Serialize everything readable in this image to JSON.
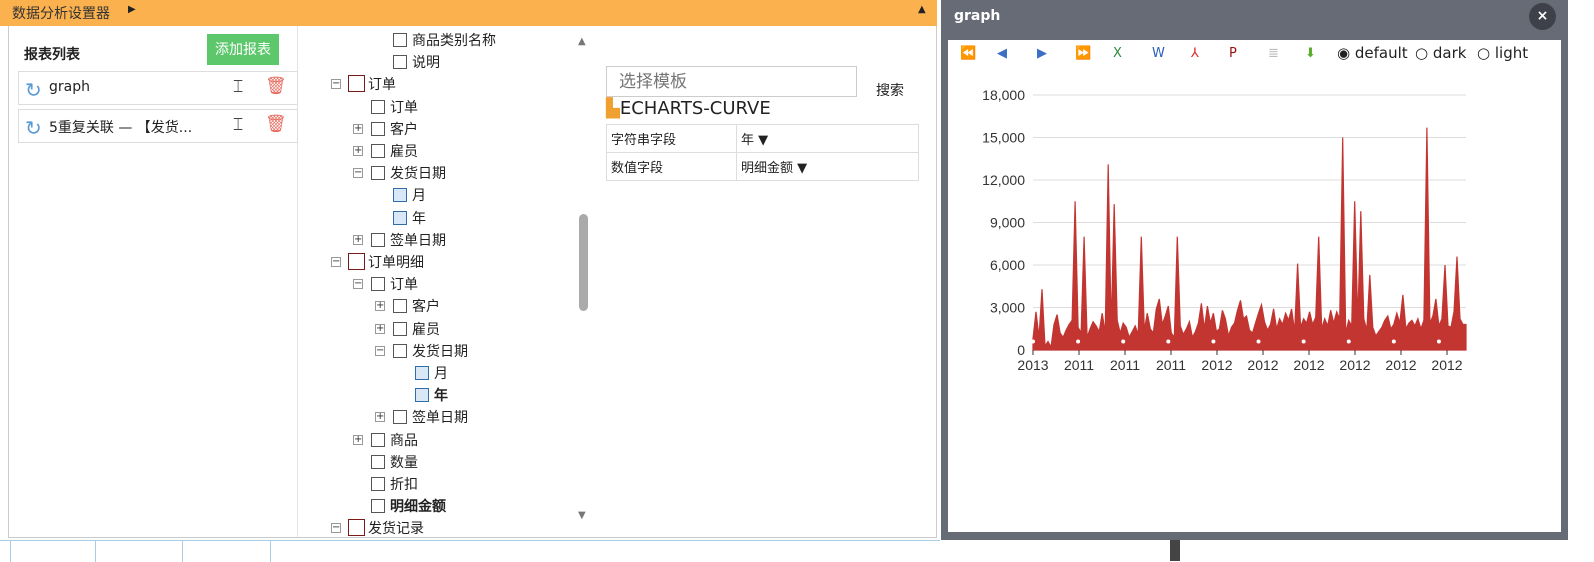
{
  "topbar": {
    "title": "数据分析设置器"
  },
  "reports": {
    "header": "报表列表",
    "add_label": "添加报表",
    "items": [
      {
        "name": "graph"
      },
      {
        "name": "5重复关联 — 【发货..."
      }
    ]
  },
  "tree": [
    {
      "label": "商品类别名称",
      "level": 2,
      "type": "fld",
      "exp": ""
    },
    {
      "label": "说明",
      "level": 2,
      "type": "fld",
      "exp": ""
    },
    {
      "label": "订单",
      "level": 0,
      "type": "tbl",
      "exp": "-"
    },
    {
      "label": "订单",
      "level": 1,
      "type": "fld",
      "exp": ""
    },
    {
      "label": "客户",
      "level": 1,
      "type": "fld",
      "exp": "+"
    },
    {
      "label": "雇员",
      "level": 1,
      "type": "fld",
      "exp": "+"
    },
    {
      "label": "发货日期",
      "level": 1,
      "type": "fld",
      "exp": "-"
    },
    {
      "label": "月",
      "level": 2,
      "type": "dt",
      "exp": ""
    },
    {
      "label": "年",
      "level": 2,
      "type": "dt",
      "exp": ""
    },
    {
      "label": "签单日期",
      "level": 1,
      "type": "fld",
      "exp": "+"
    },
    {
      "label": "订单明细",
      "level": 0,
      "type": "tbl",
      "exp": "-"
    },
    {
      "label": "订单",
      "level": 1,
      "type": "fld",
      "exp": "-"
    },
    {
      "label": "客户",
      "level": 2,
      "type": "fld",
      "exp": "+"
    },
    {
      "label": "雇员",
      "level": 2,
      "type": "fld",
      "exp": "+"
    },
    {
      "label": "发货日期",
      "level": 2,
      "type": "fld",
      "exp": "-"
    },
    {
      "label": "月",
      "level": 3,
      "type": "dt",
      "exp": ""
    },
    {
      "label": "年",
      "level": 3,
      "type": "dt",
      "exp": "",
      "bold": true
    },
    {
      "label": "签单日期",
      "level": 2,
      "type": "fld",
      "exp": "+"
    },
    {
      "label": "商品",
      "level": 1,
      "type": "fld",
      "exp": "+"
    },
    {
      "label": "数量",
      "level": 1,
      "type": "fld",
      "exp": ""
    },
    {
      "label": "折扣",
      "level": 1,
      "type": "fld",
      "exp": ""
    },
    {
      "label": "明细金额",
      "level": 1,
      "type": "fld",
      "exp": "",
      "bold": true
    },
    {
      "label": "发货记录",
      "level": 0,
      "type": "tbl",
      "exp": "-"
    }
  ],
  "config": {
    "template_placeholder": "选择模板",
    "search_label": "搜索",
    "chart_type": "ECHARTS-CURVE",
    "rows": [
      {
        "field": "字符串字段",
        "value": "年 ▼"
      },
      {
        "field": "数值字段",
        "value": "明细金额 ▼"
      }
    ]
  },
  "window": {
    "title": "graph",
    "close": "×",
    "toolbar": [
      {
        "icon": "first-page-icon",
        "glyph": "⏪",
        "color": "#3b6fc4"
      },
      {
        "icon": "prev-page-icon",
        "glyph": "◀",
        "color": "#3b6fc4"
      },
      {
        "icon": "next-page-icon",
        "glyph": "▶",
        "color": "#3b6fc4"
      },
      {
        "icon": "last-page-icon",
        "glyph": "⏩",
        "color": "#3b6fc4"
      },
      {
        "icon": "excel-icon",
        "glyph": "X",
        "color": "#2e8b3a"
      },
      {
        "icon": "word-icon",
        "glyph": "W",
        "color": "#2b5fb8"
      },
      {
        "icon": "pdf-icon",
        "glyph": "⅄",
        "color": "#d22"
      },
      {
        "icon": "print-icon",
        "glyph": "P",
        "color": "#9b1010"
      },
      {
        "icon": "document-icon",
        "glyph": "≣",
        "color": "#bbb"
      },
      {
        "icon": "download-icon",
        "glyph": "⬇",
        "color": "#5aad2c"
      }
    ],
    "themes": [
      {
        "label": "default",
        "selected": true
      },
      {
        "label": "dark",
        "selected": false
      },
      {
        "label": "light",
        "selected": false
      }
    ]
  },
  "chart_data": {
    "type": "line",
    "color": "#c23531",
    "ylim": [
      0,
      18000
    ],
    "y_ticks": [
      "0",
      "3,000",
      "6,000",
      "9,000",
      "12,000",
      "15,000",
      "18,000"
    ],
    "y_tick_values": [
      0,
      3000,
      6000,
      9000,
      12000,
      15000,
      18000
    ],
    "x_tick_labels": [
      "2013",
      "2011",
      "2011",
      "2011",
      "2012",
      "2012",
      "2012",
      "2012",
      "2012",
      "2012"
    ],
    "grid": true,
    "values": [
      800,
      2700,
      900,
      4300,
      300,
      600,
      200,
      1800,
      2500,
      1200,
      900,
      1400,
      1800,
      2100,
      10500,
      1600,
      1200,
      8000,
      900,
      1500,
      2000,
      1700,
      1300,
      2600,
      1200,
      13100,
      1500,
      10300,
      2100,
      1200,
      1900,
      1600,
      900,
      1300,
      1700,
      1100,
      8000,
      1400,
      2600,
      1500,
      1200,
      2900,
      3600,
      1800,
      2400,
      3100,
      1200,
      900,
      8000,
      1700,
      1100,
      1500,
      2000,
      900,
      1300,
      1900,
      3300,
      1500,
      3100,
      1900,
      2600,
      1300,
      1500,
      2800,
      2200,
      1000,
      1600,
      1900,
      2800,
      3500,
      2200,
      2400,
      1400,
      1200,
      1900,
      2600,
      3200,
      2000,
      1400,
      1800,
      2900,
      1500,
      2200,
      1800,
      2600,
      2100,
      2900,
      1300,
      6100,
      1600,
      2200,
      1900,
      2700,
      1800,
      2300,
      8000,
      1500,
      2200,
      1700,
      2800,
      1900,
      2700,
      2200,
      15000,
      1200,
      2100,
      1700,
      10500,
      2000,
      9800,
      2200,
      1400,
      5300,
      1600,
      1000,
      1300,
      1600,
      2100,
      2400,
      1500,
      1800,
      2600,
      1900,
      3900,
      1500,
      1900,
      2100,
      1700,
      2200,
      1500,
      2100,
      15700,
      1900,
      2400,
      3600,
      1700,
      2200,
      6000,
      1700,
      1600,
      2700,
      6600,
      2200,
      1800,
      1800
    ]
  }
}
